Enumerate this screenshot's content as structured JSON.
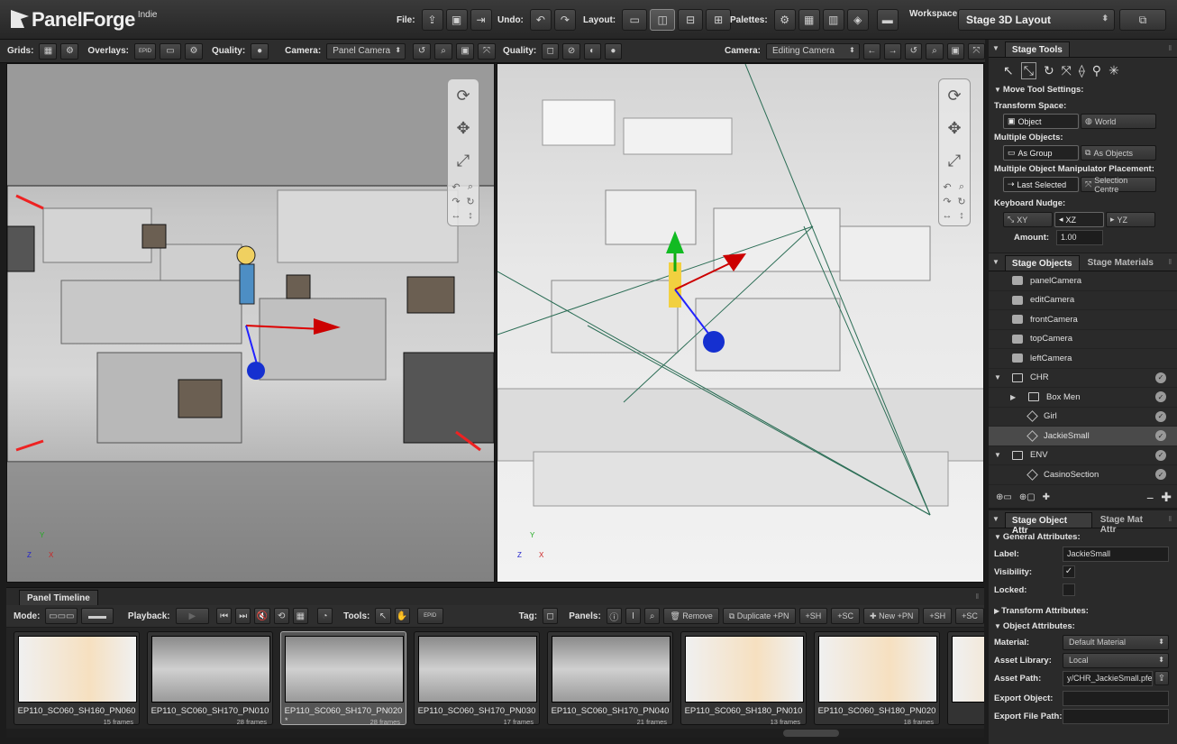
{
  "app": {
    "name": "PanelForge",
    "edition": "Indie"
  },
  "toolbar": {
    "file_label": "File:",
    "undo_label": "Undo:",
    "layout_label": "Layout:",
    "palettes_label": "Palettes:",
    "workspace_label": "Workspace:",
    "workspace_value": "Stage 3D Layout"
  },
  "left_viewport": {
    "grids_label": "Grids:",
    "overlays_label": "Overlays:",
    "overlays_badge": "EPID",
    "quality_label": "Quality:",
    "camera_label": "Camera:",
    "camera_value": "Panel Camera"
  },
  "right_viewport": {
    "quality_label": "Quality:",
    "camera_label": "Camera:",
    "camera_value": "Editing Camera"
  },
  "timeline": {
    "tab": "Panel Timeline",
    "mode_label": "Mode:",
    "playback_label": "Playback:",
    "tools_label": "Tools:",
    "tools_badge": "EPID",
    "tag_label": "Tag:",
    "panels_label": "Panels:",
    "remove": "Remove",
    "duplicate": "Duplicate",
    "plus_pn": "+PN",
    "plus_sh": "+SH",
    "plus_sc": "+SC",
    "new": "New",
    "thumbs": [
      {
        "name": "EP110_SC060_SH160_PN060",
        "frames": "15 frames",
        "kind": "face",
        "selected": false,
        "star": ""
      },
      {
        "name": "EP110_SC060_SH170_PN010",
        "frames": "28 frames",
        "kind": "scene",
        "selected": false,
        "star": ""
      },
      {
        "name": "EP110_SC060_SH170_PN020",
        "frames": "28 frames",
        "kind": "scene",
        "selected": true,
        "star": "*"
      },
      {
        "name": "EP110_SC060_SH170_PN030",
        "frames": "17 frames",
        "kind": "scene",
        "selected": false,
        "star": ""
      },
      {
        "name": "EP110_SC060_SH170_PN040",
        "frames": "21 frames",
        "kind": "scene",
        "selected": false,
        "star": ""
      },
      {
        "name": "EP110_SC060_SH180_PN010",
        "frames": "13 frames",
        "kind": "face",
        "selected": false,
        "star": ""
      },
      {
        "name": "EP110_SC060_SH180_PN020",
        "frames": "18 frames",
        "kind": "face",
        "selected": false,
        "star": ""
      },
      {
        "name": "EP110_S",
        "frames": "",
        "kind": "face",
        "selected": false,
        "star": ""
      }
    ]
  },
  "stage_tools": {
    "tab": "Stage Tools",
    "move_settings": "Move Tool Settings:",
    "transform_space_label": "Transform Space:",
    "transform_space": [
      "Object",
      "World"
    ],
    "multiple_objects_label": "Multiple Objects:",
    "multiple_objects": [
      "As Group",
      "As Objects"
    ],
    "placement_label": "Multiple Object Manipulator Placement:",
    "placement": [
      "Last Selected",
      "Selection Centre"
    ],
    "nudge_label": "Keyboard Nudge:",
    "nudge": [
      "XY",
      "XZ",
      "YZ"
    ],
    "amount_label": "Amount:",
    "amount_value": "1.00"
  },
  "stage_objects": {
    "tabs": [
      "Stage Objects",
      "Stage Materials"
    ],
    "items": [
      {
        "label": "panelCamera",
        "type": "cam",
        "indent": 0,
        "toggle": "",
        "selected": false,
        "check": false
      },
      {
        "label": "editCamera",
        "type": "cam",
        "indent": 0,
        "toggle": "",
        "selected": false,
        "check": false
      },
      {
        "label": "frontCamera",
        "type": "cam",
        "indent": 0,
        "toggle": "",
        "selected": false,
        "check": false
      },
      {
        "label": "topCamera",
        "type": "cam",
        "indent": 0,
        "toggle": "",
        "selected": false,
        "check": false
      },
      {
        "label": "leftCamera",
        "type": "cam",
        "indent": 0,
        "toggle": "",
        "selected": false,
        "check": false
      },
      {
        "label": "CHR",
        "type": "fold",
        "indent": 0,
        "toggle": "▼",
        "selected": false,
        "check": true
      },
      {
        "label": "Box Men",
        "type": "fold",
        "indent": 1,
        "toggle": "▶",
        "selected": false,
        "check": true
      },
      {
        "label": "Girl",
        "type": "obj",
        "indent": 1,
        "toggle": "",
        "selected": false,
        "check": true
      },
      {
        "label": "JackieSmall",
        "type": "obj",
        "indent": 1,
        "toggle": "",
        "selected": true,
        "check": true
      },
      {
        "label": "ENV",
        "type": "fold",
        "indent": 0,
        "toggle": "▼",
        "selected": false,
        "check": true
      },
      {
        "label": "CasinoSection",
        "type": "obj",
        "indent": 1,
        "toggle": "",
        "selected": false,
        "check": true
      }
    ]
  },
  "attributes": {
    "tabs": [
      "Stage Object Attr",
      "Stage Mat Attr"
    ],
    "general": "General Attributes:",
    "label_label": "Label:",
    "label_value": "JackieSmall",
    "visibility_label": "Visibility:",
    "visibility_check": "✓",
    "locked_label": "Locked:",
    "transform": "Transform Attributes:",
    "object": "Object Attributes:",
    "material_label": "Material:",
    "material_value": "Default Material",
    "asset_library_label": "Asset Library:",
    "asset_library_value": "Local",
    "asset_path_label": "Asset Path:",
    "asset_path_value": "y/CHR_JackieSmall.pfe",
    "export_object_label": "Export Object:",
    "export_path_label": "Export File Path:"
  }
}
